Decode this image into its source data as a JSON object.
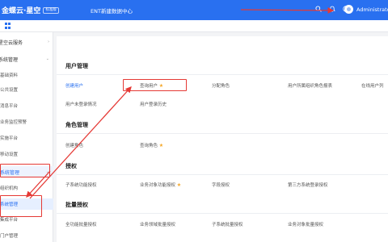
{
  "header": {
    "logo": "金蝶云·星空",
    "badge": "标准版",
    "center_title": "ENT新建数据中心",
    "icons": [
      "search-icon",
      "bell-icon",
      "help-icon"
    ],
    "user": "Administrator"
  },
  "sidebar": {
    "items": [
      {
        "label": "星空云服务",
        "chevron": "›"
      },
      {
        "label": "系统管理",
        "chevron": "⌄"
      },
      {
        "label": "基础资料"
      },
      {
        "label": "公共设置"
      },
      {
        "label": "消息平台"
      },
      {
        "label": "业务监控预警"
      },
      {
        "label": "实施平台"
      },
      {
        "label": "移动设置"
      },
      {
        "label": "系统管理",
        "chevron": "⌄"
      },
      {
        "label": "组织机构"
      },
      {
        "label": "系统管理"
      },
      {
        "label": "集成平台"
      },
      {
        "label": "门户管理"
      }
    ]
  },
  "sections": {
    "user_mgmt": {
      "title": "用户管理",
      "links": [
        "创建用户",
        "查询用户",
        "分配角色",
        "用户所属组织角色报表",
        "在线用户列",
        "用户未登录情况",
        "用户登录历史"
      ]
    },
    "role_mgmt": {
      "title": "角色管理",
      "links": [
        "创建角色",
        "查询角色"
      ]
    },
    "auth": {
      "title": "授权",
      "links": [
        "子系统功能授权",
        "业务对象功能授权",
        "字段授权",
        "第三方系统登录授权"
      ]
    },
    "batch_auth": {
      "title": "批量授权",
      "links": [
        "全功能批量授权",
        "业务领域批量授权",
        "子系统批量授权",
        "业务对象批量授权"
      ]
    }
  },
  "colors": {
    "primary": "#2970f0",
    "highlight": "#e53935",
    "star": "#f5a623"
  }
}
